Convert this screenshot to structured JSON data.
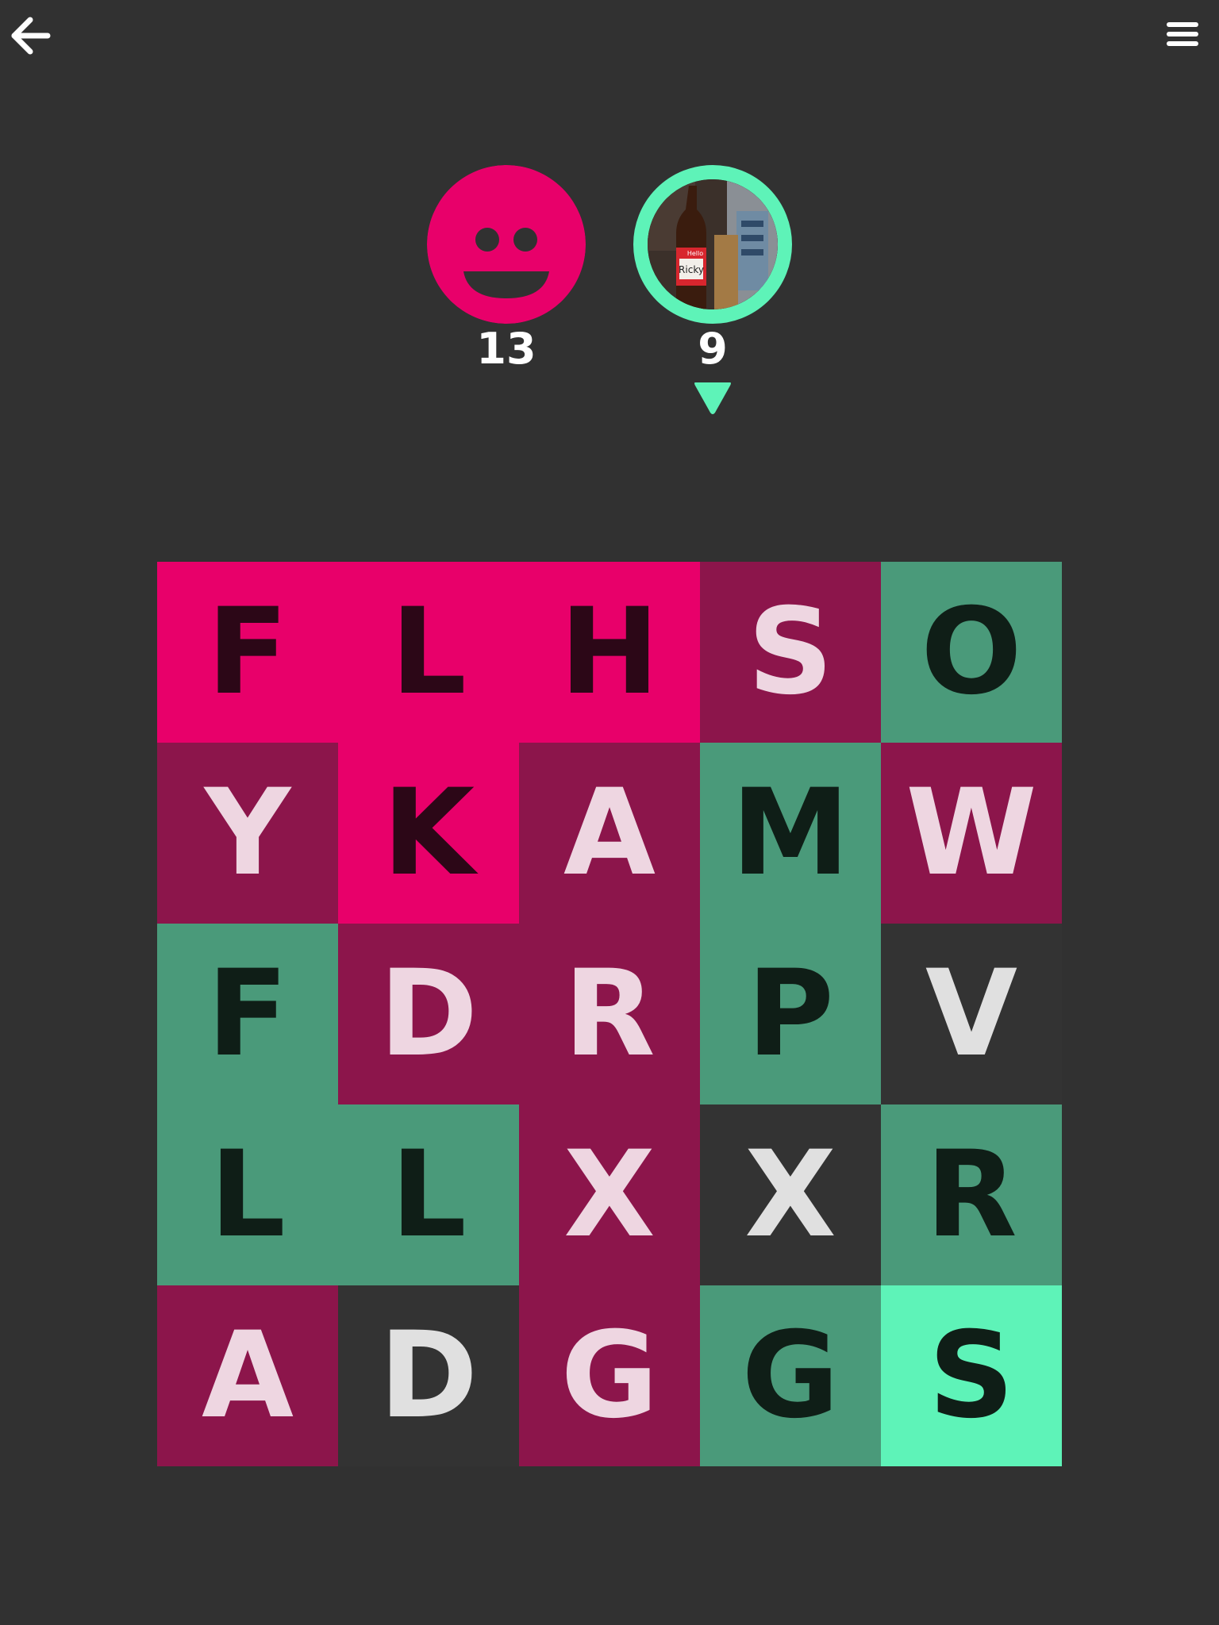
{
  "header": {
    "back_icon": "back-arrow-icon",
    "menu_icon": "hamburger-menu-icon"
  },
  "players": [
    {
      "name": "",
      "avatar": "smiley-face-icon",
      "score": "13",
      "color": "#e8006a",
      "is_turn": false
    },
    {
      "name": "",
      "avatar": "photo-avatar",
      "score": "9",
      "color": "#5ef3b8",
      "is_turn": true
    }
  ],
  "colors": {
    "background": "#313131",
    "p1_locked": "#e8006a",
    "p1_owned": "#8c154b",
    "p2_locked": "#5ef3b8",
    "p2_owned": "#4a9a7a",
    "neutral": "#333333",
    "text_dark_on_pink": "#2c0717",
    "text_dark_on_green": "#0f1e17",
    "text_light": "#eed6e1",
    "text_light_neutral": "#e0e0e0"
  },
  "board": {
    "rows": [
      [
        {
          "letter": "F",
          "owner": "p1_locked"
        },
        {
          "letter": "L",
          "owner": "p1_locked"
        },
        {
          "letter": "H",
          "owner": "p1_locked"
        },
        {
          "letter": "S",
          "owner": "p1_owned"
        },
        {
          "letter": "O",
          "owner": "p2_owned"
        }
      ],
      [
        {
          "letter": "Y",
          "owner": "p1_owned"
        },
        {
          "letter": "K",
          "owner": "p1_locked"
        },
        {
          "letter": "A",
          "owner": "p1_owned"
        },
        {
          "letter": "M",
          "owner": "p2_owned"
        },
        {
          "letter": "W",
          "owner": "p1_owned"
        }
      ],
      [
        {
          "letter": "F",
          "owner": "p2_owned"
        },
        {
          "letter": "D",
          "owner": "p1_owned"
        },
        {
          "letter": "R",
          "owner": "p1_owned"
        },
        {
          "letter": "P",
          "owner": "p2_owned"
        },
        {
          "letter": "V",
          "owner": "neutral"
        }
      ],
      [
        {
          "letter": "L",
          "owner": "p2_owned"
        },
        {
          "letter": "L",
          "owner": "p2_owned"
        },
        {
          "letter": "X",
          "owner": "p1_owned"
        },
        {
          "letter": "X",
          "owner": "neutral"
        },
        {
          "letter": "R",
          "owner": "p2_owned"
        }
      ],
      [
        {
          "letter": "A",
          "owner": "p1_owned"
        },
        {
          "letter": "D",
          "owner": "neutral"
        },
        {
          "letter": "G",
          "owner": "p1_owned"
        },
        {
          "letter": "G",
          "owner": "p2_owned"
        },
        {
          "letter": "S",
          "owner": "p2_locked"
        }
      ]
    ]
  }
}
